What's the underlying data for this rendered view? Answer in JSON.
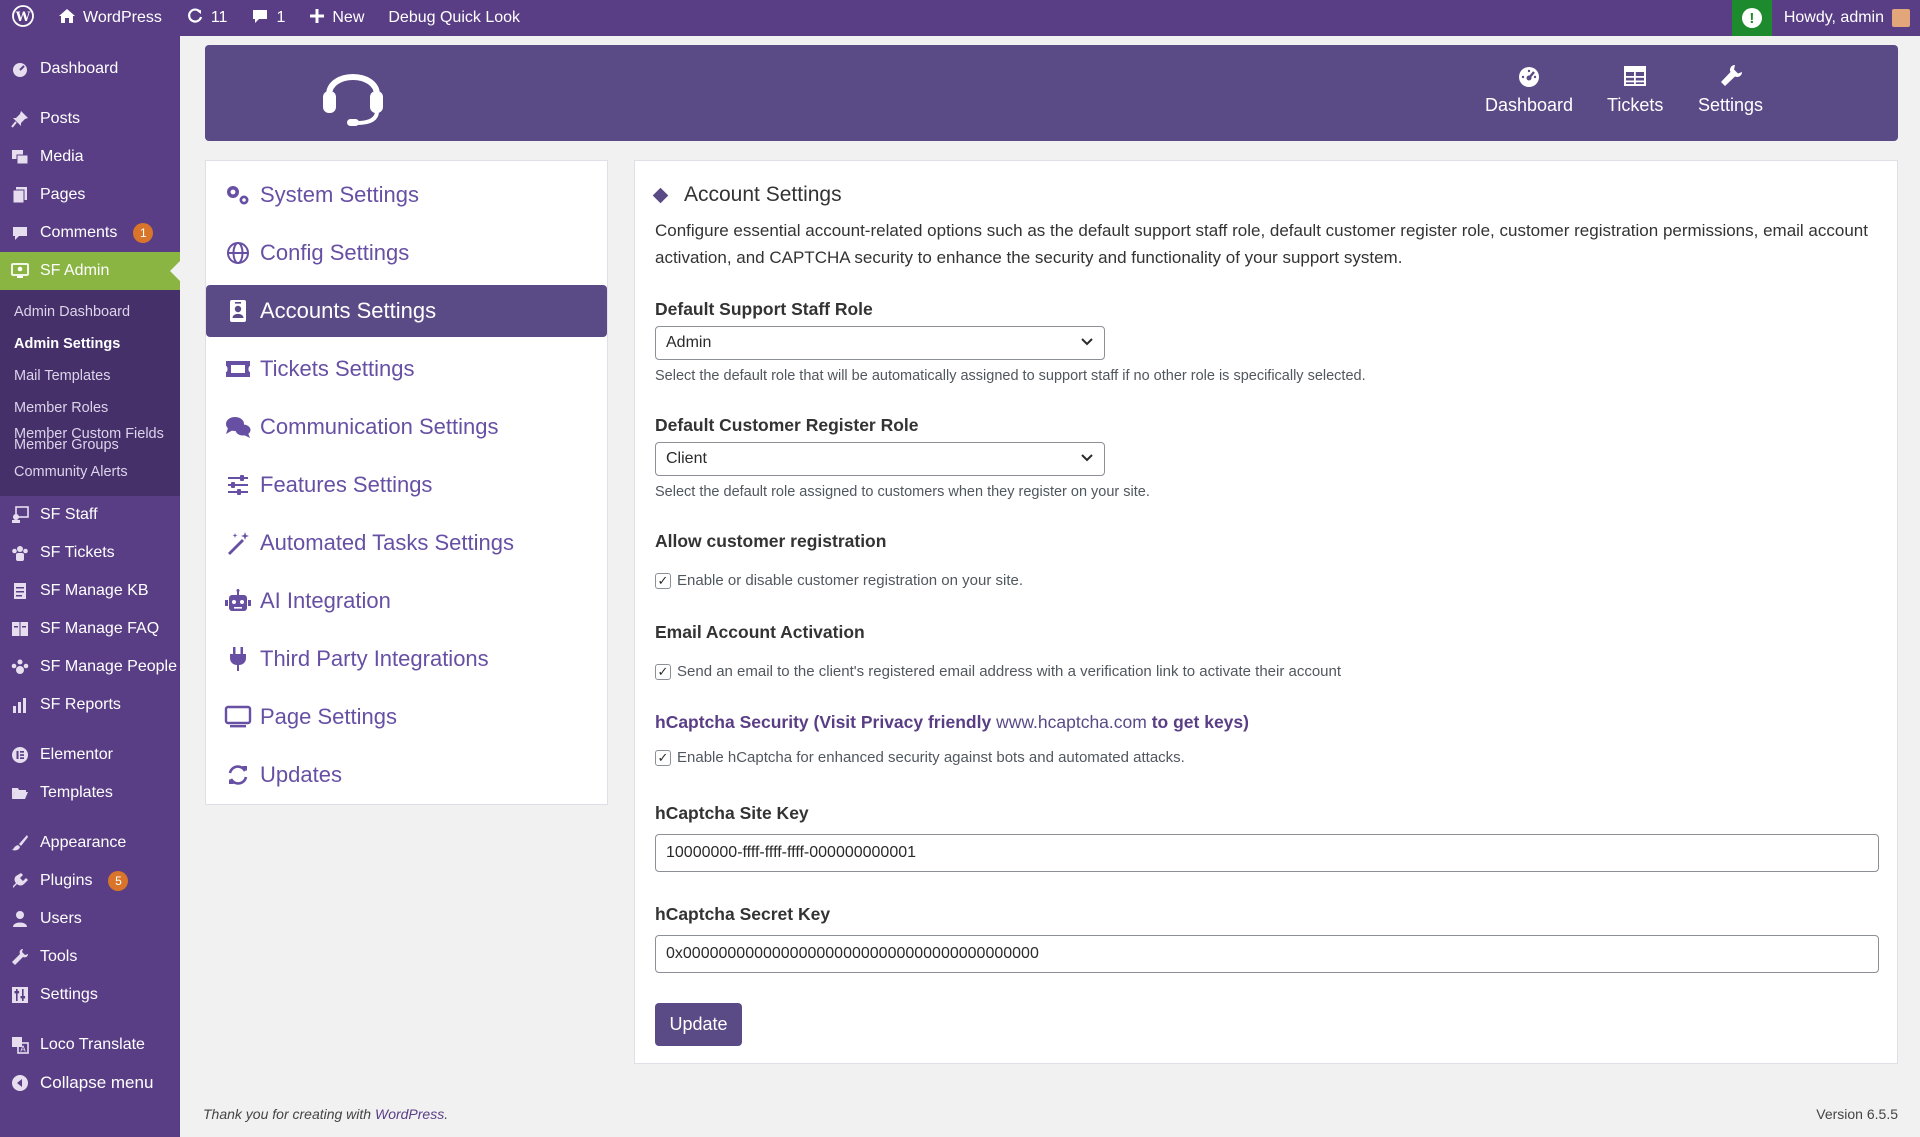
{
  "adminbar": {
    "site_name": "WordPress",
    "updates_count": "11",
    "comments_count": "1",
    "new_label": "New",
    "debug_label": "Debug Quick Look",
    "howdy": "Howdy, admin"
  },
  "sidebar": {
    "dashboard": "Dashboard",
    "posts": "Posts",
    "media": "Media",
    "pages": "Pages",
    "comments": "Comments",
    "comments_badge": "1",
    "sf_admin": "SF Admin",
    "submenu": {
      "admin_dashboard": "Admin Dashboard",
      "admin_settings": "Admin Settings",
      "mail_templates": "Mail Templates",
      "member_roles": "Member Roles",
      "member_custom_fields": "Member Custom Fields",
      "member_groups": "Member Groups",
      "community_alerts": "Community Alerts"
    },
    "sf_staff": "SF Staff",
    "sf_tickets": "SF Tickets",
    "sf_manage_kb": "SF Manage KB",
    "sf_manage_faq": "SF Manage FAQ",
    "sf_manage_people": "SF Manage People",
    "sf_reports": "SF Reports",
    "elementor": "Elementor",
    "templates": "Templates",
    "appearance": "Appearance",
    "plugins": "Plugins",
    "plugins_badge": "5",
    "users": "Users",
    "tools": "Tools",
    "settings": "Settings",
    "loco_translate": "Loco Translate",
    "collapse": "Collapse menu"
  },
  "header": {
    "nav": {
      "dashboard": "Dashboard",
      "tickets": "Tickets",
      "settings": "Settings"
    }
  },
  "tabs": {
    "system": "System Settings",
    "config": "Config Settings",
    "accounts": "Accounts Settings",
    "tickets": "Tickets Settings",
    "communication": "Communication Settings",
    "features": "Features Settings",
    "automated": "Automated Tasks Settings",
    "ai": "AI Integration",
    "third_party": "Third Party Integrations",
    "page": "Page Settings",
    "updates": "Updates"
  },
  "card": {
    "title": "Account Settings",
    "description": "Configure essential account-related options such as the default support staff role, default customer register role, customer registration permissions, email account activation, and CAPTCHA security to enhance the security and functionality of your support system.",
    "staff_role_label": "Default Support Staff Role",
    "staff_role_value": "Admin",
    "staff_role_hint": "Select the default role that will be automatically assigned to support staff if no other role is specifically selected.",
    "customer_role_label": "Default Customer Register Role",
    "customer_role_value": "Client",
    "customer_role_hint": "Select the default role assigned to customers when they register on your site.",
    "allow_reg_label": "Allow customer registration",
    "allow_reg_check": "Enable or disable customer registration on your site.",
    "email_act_label": "Email Account Activation",
    "email_act_check": "Send an email to the client's registered email address with a verification link to activate their account",
    "hcaptcha_label_pre": "hCaptcha Security (Visit Privacy friendly",
    "hcaptcha_link": "www.hcaptcha.com",
    "hcaptcha_label_post": "to get keys)",
    "hcaptcha_check": "Enable hCaptcha for enhanced security against bots and automated attacks.",
    "site_key_label": "hCaptcha Site Key",
    "site_key_value": "10000000-ffff-ffff-ffff-000000000001",
    "secret_key_label": "hCaptcha Secret Key",
    "secret_key_value": "0x0000000000000000000000000000000000000000",
    "update_button": "Update"
  },
  "footer": {
    "thanks_pre": "Thank you for creating with",
    "thanks_link": "WordPress",
    "version": "Version 6.5.5"
  },
  "colors": {
    "brand_purple": "#5a3e85",
    "header_purple": "#5a4a86",
    "active_green": "#8ab543",
    "badge_orange": "#d8752a",
    "alert_green": "#1e8a2e"
  }
}
